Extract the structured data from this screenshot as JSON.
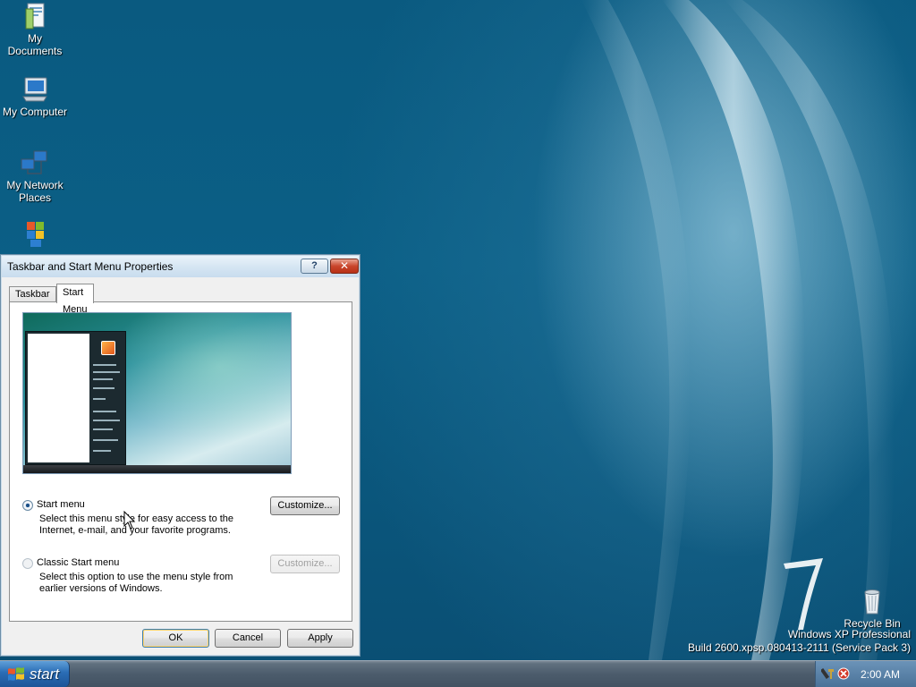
{
  "desktop": {
    "icons": [
      {
        "label": "My Documents"
      },
      {
        "label": "My Computer"
      },
      {
        "label": "My Network Places"
      },
      {
        "label": "Recycle Bin"
      }
    ],
    "os_name": "Windows XP Professional",
    "build_info": "Build 2600.xpsp.080413-2111 (Service Pack 3)",
    "brand_mark": "7"
  },
  "dialog": {
    "title": "Taskbar and Start Menu Properties",
    "help_label": "?",
    "close_label": "✕",
    "tabs": [
      {
        "label": "Taskbar",
        "active": false
      },
      {
        "label": "Start Menu",
        "active": true
      }
    ],
    "options": [
      {
        "label": "Start menu",
        "description": "Select this menu style for easy access to the Internet, e-mail, and your favorite programs.",
        "selected": true,
        "customize_label": "Customize...",
        "customize_enabled": true
      },
      {
        "label": "Classic Start menu",
        "description": "Select this option to use the menu style from earlier versions of Windows.",
        "selected": false,
        "customize_label": "Customize...",
        "customize_enabled": false
      }
    ],
    "buttons": {
      "ok": "OK",
      "cancel": "Cancel",
      "apply": "Apply"
    }
  },
  "taskbar": {
    "start_label": "start",
    "clock": "2:00 AM"
  },
  "colors": {
    "desktop_bg": "#0b5f86",
    "taskbar_bg": "#4c5c6c",
    "start_button": "#2a6cb5",
    "close_button": "#c9462c"
  }
}
